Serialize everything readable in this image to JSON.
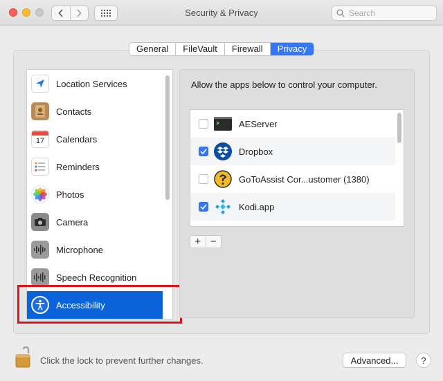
{
  "window": {
    "title": "Security & Privacy"
  },
  "search": {
    "placeholder": "Search"
  },
  "tabs": [
    {
      "label": "General"
    },
    {
      "label": "FileVault"
    },
    {
      "label": "Firewall"
    },
    {
      "label": "Privacy",
      "selected": true
    }
  ],
  "sidebar": {
    "items": [
      {
        "label": "Location Services",
        "icon": "location-arrow-icon"
      },
      {
        "label": "Contacts",
        "icon": "contacts-book-icon"
      },
      {
        "label": "Calendars",
        "icon": "calendar-icon",
        "icon_text": "17"
      },
      {
        "label": "Reminders",
        "icon": "reminders-list-icon"
      },
      {
        "label": "Photos",
        "icon": "photos-flower-icon"
      },
      {
        "label": "Camera",
        "icon": "camera-icon"
      },
      {
        "label": "Microphone",
        "icon": "microphone-waveform-icon"
      },
      {
        "label": "Speech Recognition",
        "icon": "speech-waveform-icon"
      },
      {
        "label": "Accessibility",
        "icon": "accessibility-icon",
        "selected": true
      }
    ]
  },
  "privacy": {
    "prompt": "Allow the apps below to control your computer.",
    "apps": [
      {
        "name": "AEServer",
        "checked": false,
        "icon": "terminal-icon"
      },
      {
        "name": "Dropbox",
        "checked": true,
        "icon": "dropbox-icon"
      },
      {
        "name": "GoToAssist Cor...ustomer (1380)",
        "checked": false,
        "icon": "gotoassist-icon"
      },
      {
        "name": "Kodi.app",
        "checked": true,
        "icon": "kodi-icon"
      }
    ],
    "add_label": "+",
    "remove_label": "−"
  },
  "footer": {
    "lock_text": "Click the lock to prevent further changes.",
    "advanced_label": "Advanced...",
    "help_label": "?"
  },
  "colors": {
    "accent": "#3478f6",
    "selection": "#0a63d8",
    "highlight": "#e0151b"
  }
}
